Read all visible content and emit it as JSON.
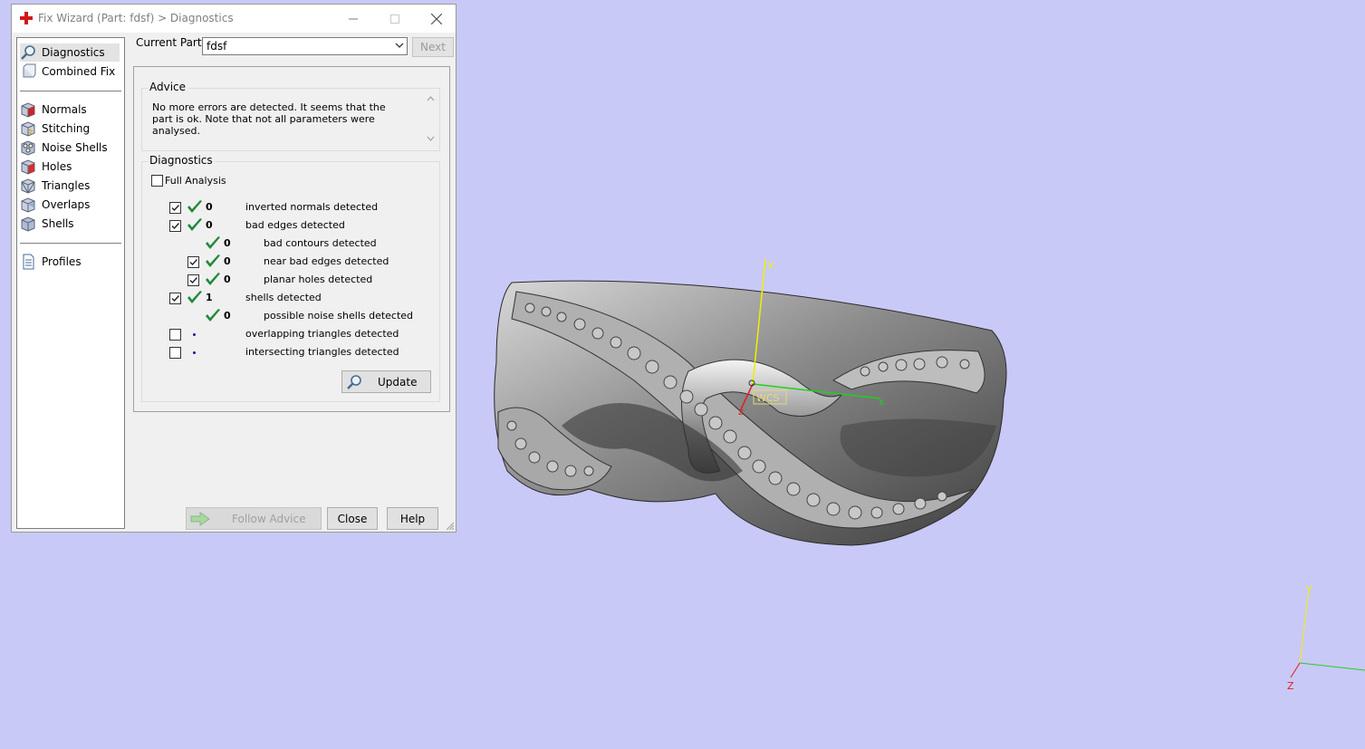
{
  "window": {
    "title": "Fix Wizard (Part: fdsf) > Diagnostics",
    "controls": [
      "minimize",
      "maximize",
      "close"
    ]
  },
  "sidebar": {
    "groups": [
      [
        {
          "label": "Diagnostics",
          "icon": "magnifier-icon",
          "selected": true
        },
        {
          "label": "Combined Fix",
          "icon": "combined-fix-icon"
        }
      ],
      [
        {
          "label": "Normals",
          "icon": "normals-cube-icon"
        },
        {
          "label": "Stitching",
          "icon": "stitching-cube-icon"
        },
        {
          "label": "Noise Shells",
          "icon": "noise-shells-icon"
        },
        {
          "label": "Holes",
          "icon": "holes-cube-icon"
        },
        {
          "label": "Triangles",
          "icon": "triangles-cube-icon"
        },
        {
          "label": "Overlaps",
          "icon": "overlaps-cube-icon"
        },
        {
          "label": "Shells",
          "icon": "shells-cube-icon"
        }
      ],
      [
        {
          "label": "Profiles",
          "icon": "document-icon"
        }
      ]
    ]
  },
  "header": {
    "current_part_label": "Current Part:",
    "current_part_value": "fdsf",
    "next_label": "Next"
  },
  "advice": {
    "title": "Advice",
    "text": "No more errors are detected. It seems that the part is ok. Note that not all parameters were analysed."
  },
  "diagnostics": {
    "title": "Diagnostics",
    "full_analysis_label": "Full Analysis",
    "full_analysis_checked": false,
    "rows": [
      {
        "checkbox": true,
        "checked": true,
        "status": "ok",
        "count": "0",
        "label": "inverted normals detected",
        "indent": 0
      },
      {
        "checkbox": true,
        "checked": true,
        "status": "ok",
        "count": "0",
        "label": "bad edges detected",
        "indent": 0
      },
      {
        "checkbox": false,
        "checked": false,
        "status": "ok",
        "count": "0",
        "label": "bad contours detected",
        "indent": 1
      },
      {
        "checkbox": true,
        "checked": true,
        "status": "ok",
        "count": "0",
        "label": "near bad edges detected",
        "indent": 1
      },
      {
        "checkbox": true,
        "checked": true,
        "status": "ok",
        "count": "0",
        "label": "planar holes detected",
        "indent": 1
      },
      {
        "checkbox": true,
        "checked": true,
        "status": "ok",
        "count": "1",
        "label": "shells detected",
        "indent": 0
      },
      {
        "checkbox": false,
        "checked": false,
        "status": "ok",
        "count": "0",
        "label": "possible noise shells detected",
        "indent": 1
      },
      {
        "checkbox": true,
        "checked": false,
        "status": "pending",
        "count": "",
        "label": "overlapping triangles detected",
        "indent": 0
      },
      {
        "checkbox": true,
        "checked": false,
        "status": "pending",
        "count": "",
        "label": "intersecting triangles detected",
        "indent": 0
      }
    ],
    "update_label": "Update"
  },
  "footer": {
    "follow_advice_label": "Follow Advice",
    "close_label": "Close",
    "help_label": "Help"
  },
  "viewport": {
    "wcs_label": "WCS",
    "axis_x": "x",
    "axis_y": "y",
    "axis_z": "z",
    "corner_axis_y": "Y",
    "corner_axis_z": "Z",
    "background_color": "#c9c9f8"
  }
}
